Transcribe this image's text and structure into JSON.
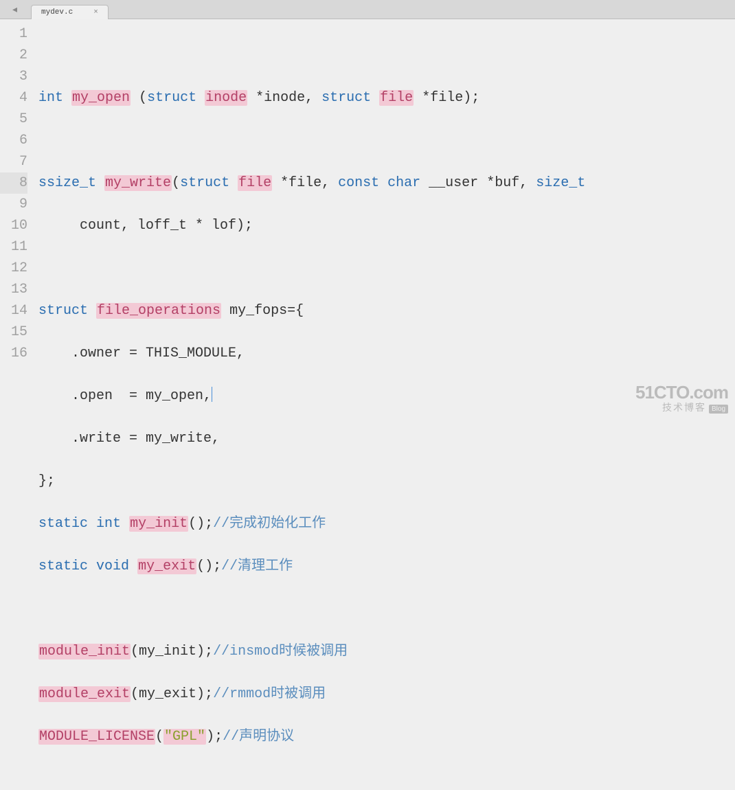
{
  "tab": {
    "filename": "mydev.c",
    "close": "×"
  },
  "gutter": [
    "1",
    "2",
    "3",
    "4",
    "",
    "5",
    "6",
    "7",
    "8",
    "9",
    "10",
    "11",
    "12",
    "13",
    "14",
    "15",
    "16"
  ],
  "code": {
    "l2_int": "int",
    "l2_myopen": "my_open",
    "l2_struct1": "struct",
    "l2_inode": "inode",
    "l2_rest1": " *inode, ",
    "l2_struct2": "struct",
    "l2_file": "file",
    "l2_rest2": " *file);",
    "l4_ssize": "ssize_t",
    "l4_mywrite": "my_write",
    "l4_struct": "struct",
    "l4_file": "file",
    "l4_mid": " *file, ",
    "l4_const": "const",
    "l4_char": "char",
    "l4_tail": " __user *buf, ",
    "l4_sizet": "size_t",
    "l4b": "     count, loff_t * lof);",
    "l6_struct": "struct",
    "l6_fops": "file_operations",
    "l6_tail": " my_fops={",
    "l7": "    .owner = THIS_MODULE,",
    "l8": "    .open  = my_open,",
    "l9": "    .write = my_write,",
    "l10": "};",
    "l11_static": "static",
    "l11_int": "int",
    "l11_fn": "my_init",
    "l11_paren": "();",
    "l11_cmt": "//完成初始化工作",
    "l12_static": "static",
    "l12_void": "void",
    "l12_fn": "my_exit",
    "l12_paren": "();",
    "l12_cmt": "//清理工作",
    "l14_fn": "module_init",
    "l14_arg": "(my_init);",
    "l14_cmt": "//insmod时候被调用",
    "l15_fn": "module_exit",
    "l15_arg": "(my_exit);",
    "l15_cmt": "//rmmod时被调用",
    "l16_fn": "MODULE_LICENSE",
    "l16_open": "(",
    "l16_str": "\"GPL\"",
    "l16_close": ");",
    "l16_cmt": "//声明协议"
  },
  "watermark": {
    "big": "51CTO.com",
    "small": "技术博客",
    "blog": "Blog"
  }
}
